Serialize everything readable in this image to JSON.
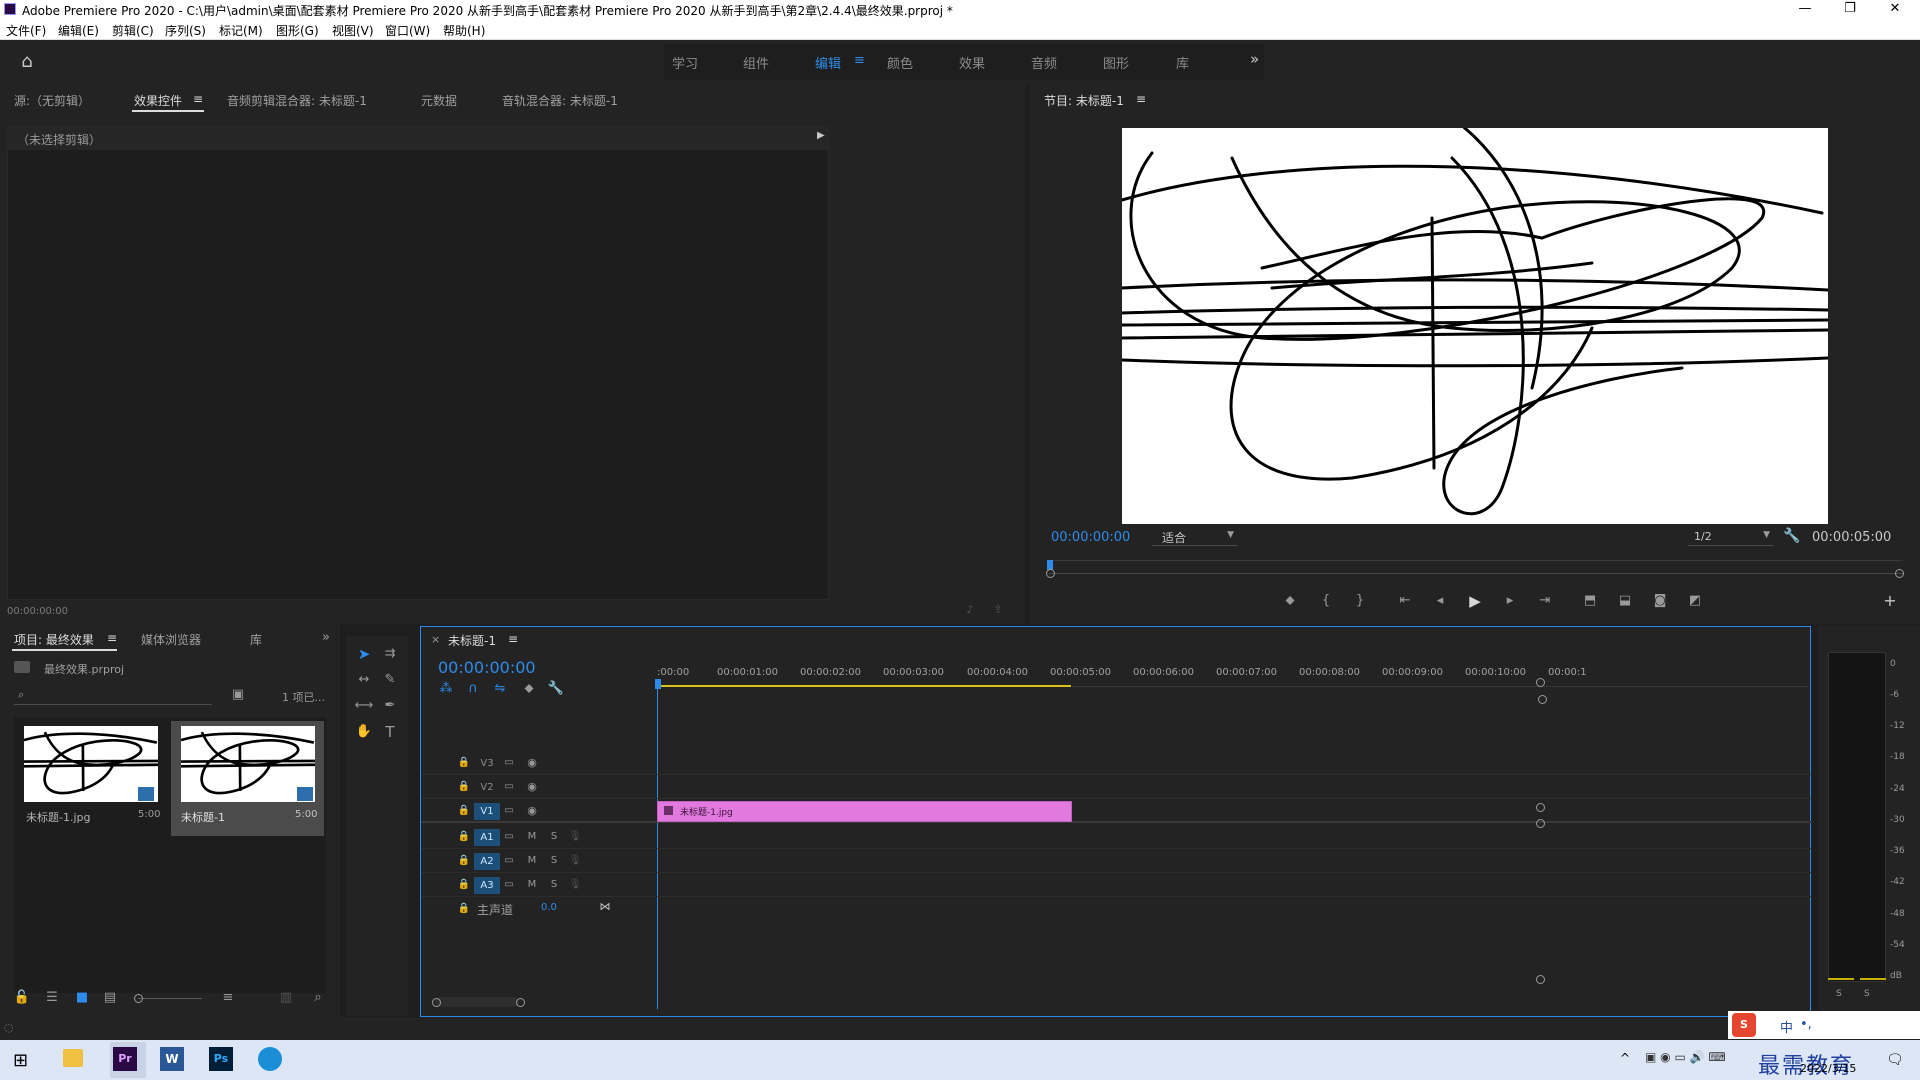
{
  "window": {
    "title": "Adobe Premiere Pro 2020 - C:\\用户\\admin\\桌面\\配套素材 Premiere Pro 2020 从新手到高手\\配套素材 Premiere Pro 2020 从新手到高手\\第2章\\2.4.4\\最终效果.prproj *",
    "minimize": "—",
    "restore": "❐",
    "close": "✕"
  },
  "menu": [
    "文件(F)",
    "编辑(E)",
    "剪辑(C)",
    "序列(S)",
    "标记(M)",
    "图形(G)",
    "视图(V)",
    "窗口(W)",
    "帮助(H)"
  ],
  "workspaces": {
    "items": [
      "学习",
      "组件",
      "编辑",
      "颜色",
      "效果",
      "音频",
      "图形",
      "库"
    ],
    "active": "编辑",
    "more": "»"
  },
  "source_panel": {
    "tabs": [
      "源:（无剪辑）",
      "效果控件",
      "音频剪辑混合器: 未标题-1",
      "元数据",
      "音轨混合器: 未标题-1"
    ],
    "active_tab": "效果控件",
    "no_clip": "（未选择剪辑）",
    "timecode": "00:00:00:00"
  },
  "program_panel": {
    "title": "节目: 未标题-1",
    "timecode": "00:00:00:00",
    "fit": "适合",
    "resolution": "1/2",
    "duration": "00:00:05:00"
  },
  "project_panel": {
    "tabs": [
      "项目: 最终效果",
      "媒体浏览器",
      "库"
    ],
    "active_tab": "项目: 最终效果",
    "file": "最终效果.prproj",
    "search_placeholder": "",
    "count": "1 项已...",
    "items": [
      {
        "name": "未标题-1.jpg",
        "duration": "5:00",
        "selected": false
      },
      {
        "name": "未标题-1",
        "duration": "5:00",
        "selected": true
      }
    ]
  },
  "timeline": {
    "sequence_tab": "未标题-1",
    "close": "×",
    "timecode": "00:00:00:00",
    "ruler": [
      ":00:00",
      "00:00:01:00",
      "00:00:02:00",
      "00:00:03:00",
      "00:00:04:00",
      "00:00:05:00",
      "00:00:06:00",
      "00:00:07:00",
      "00:00:08:00",
      "00:00:09:00",
      "00:00:10:00",
      "00:00:1"
    ],
    "video_tracks": [
      "V3",
      "V2",
      "V1"
    ],
    "audio_tracks": [
      "A1",
      "A2",
      "A3"
    ],
    "master": "主声道",
    "master_value": "0.0",
    "mute": "M",
    "solo": "S",
    "clip": {
      "name": "未标题-1.jpg",
      "color": "#e279de"
    }
  },
  "meter": {
    "ticks": [
      "0",
      "-6",
      "-12",
      "-18",
      "-24",
      "-30",
      "-36",
      "-42",
      "-48",
      "-54",
      "dB"
    ],
    "solo": [
      "S",
      "S"
    ]
  },
  "taskbar": {
    "date": "2022/3/15",
    "tray": [
      "^",
      "中",
      "•,"
    ],
    "watermark": "最需教育"
  },
  "colors": {
    "accent": "#2d8ceb",
    "clip": "#e279de",
    "panel": "#232323"
  }
}
